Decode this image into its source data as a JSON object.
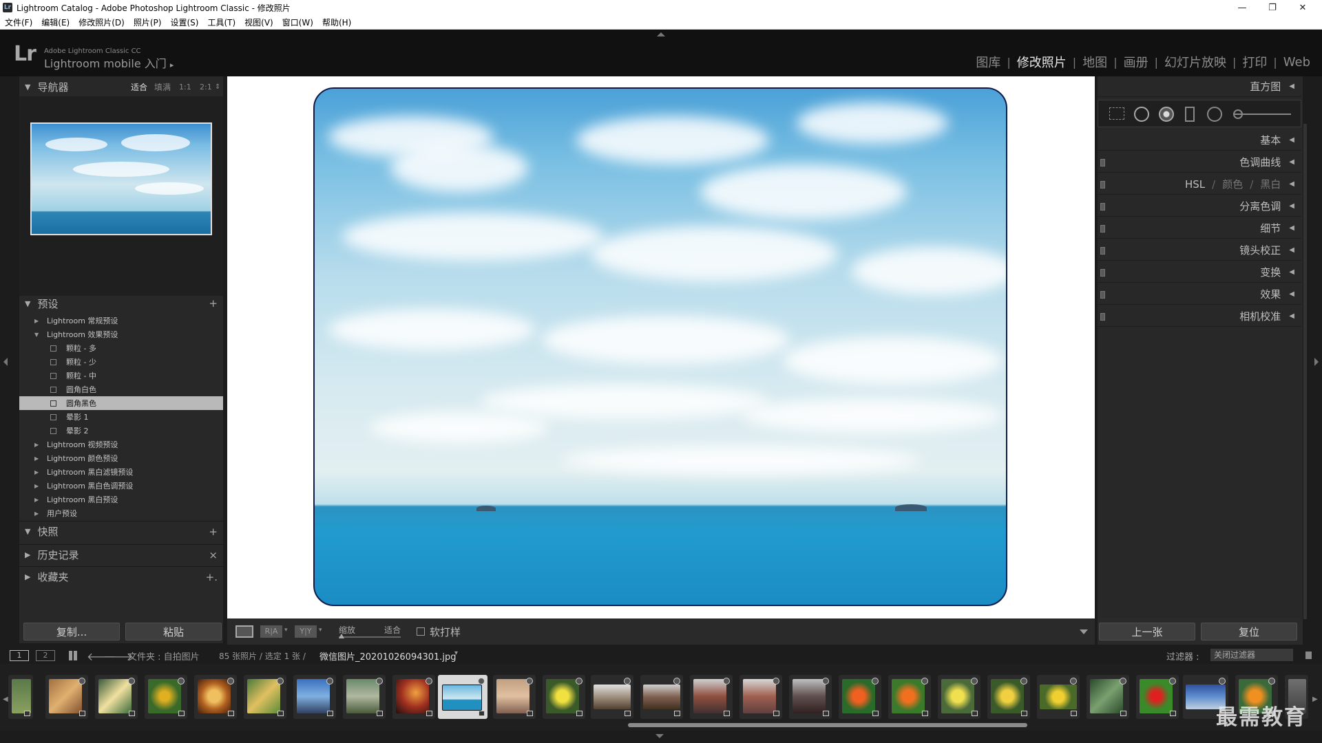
{
  "window": {
    "title": "Lightroom Catalog - Adobe Photoshop Lightroom Classic - 修改照片",
    "app_icon": "Lr",
    "controls": [
      "minimize",
      "maximize",
      "close"
    ]
  },
  "menu": [
    "文件(F)",
    "编辑(E)",
    "修改照片(D)",
    "照片(P)",
    "设置(S)",
    "工具(T)",
    "视图(V)",
    "窗口(W)",
    "帮助(H)"
  ],
  "identity": {
    "logo": "Lr",
    "product": "Adobe Lightroom Classic CC",
    "mobile": "Lightroom mobile 入门",
    "arrow": "▸"
  },
  "modules": {
    "items": [
      "图库",
      "修改照片",
      "地图",
      "画册",
      "幻灯片放映",
      "打印",
      "Web"
    ],
    "active": "修改照片",
    "separator": "|"
  },
  "navigator": {
    "title": "导航器",
    "zoom_options": [
      "适合",
      "填满",
      "1:1",
      "2:1"
    ],
    "zoom_active": "适合",
    "zoom_more": "⇕"
  },
  "presets": {
    "title": "预设",
    "add": "+",
    "folders": [
      {
        "label": "Lightroom 常规预设",
        "open": false
      },
      {
        "label": "Lightroom 效果预设",
        "open": true,
        "items": [
          "颗粒 - 多",
          "颗粒 - 少",
          "颗粒 - 中",
          "圆角白色",
          "圆角黑色",
          "晕影 1",
          "晕影 2"
        ],
        "selected": "圆角黑色"
      },
      {
        "label": "Lightroom 视频预设",
        "open": false
      },
      {
        "label": "Lightroom 颜色预设",
        "open": false
      },
      {
        "label": "Lightroom 黑白滤镜预设",
        "open": false
      },
      {
        "label": "Lightroom 黑白色调预设",
        "open": false
      },
      {
        "label": "Lightroom 黑白预设",
        "open": false
      },
      {
        "label": "用户预设",
        "open": false
      }
    ]
  },
  "snapshots": {
    "title": "快照",
    "action": "+"
  },
  "history": {
    "title": "历史记录",
    "action": "×"
  },
  "collections": {
    "title": "收藏夹",
    "action": "+."
  },
  "left_buttons": {
    "copy": "复制...",
    "paste": "粘贴"
  },
  "right_panel": {
    "histogram": "直方图",
    "sections": [
      "基本",
      "色调曲线",
      "分离色调",
      "细节",
      "镜头校正",
      "变换",
      "效果",
      "相机校准"
    ],
    "hsl": {
      "a": "HSL",
      "b": "颜色",
      "c": "黑白",
      "sep": "/"
    }
  },
  "right_buttons": {
    "prev": "上一张",
    "reset": "复位"
  },
  "toolbar": {
    "zoom_label": "缩放",
    "zoom_value": "适合",
    "softproof_label": "软打样",
    "view_ra": "R|A",
    "view_yy": "Y|Y"
  },
  "filmstrip_header": {
    "page1": "1",
    "page2": "2",
    "folder_label": "文件夹 : 自拍图片",
    "count": "85 张照片 / 选定 1 张 /",
    "filename": "微信图片_20201026094301.jpg",
    "filter_label": "过滤器 :",
    "filter_value": "关闭过滤器"
  },
  "watermark": "最需教育",
  "colors": {
    "accent_white": "#e8e8e8",
    "panel": "#282828",
    "bg": "#1c1c1c"
  }
}
